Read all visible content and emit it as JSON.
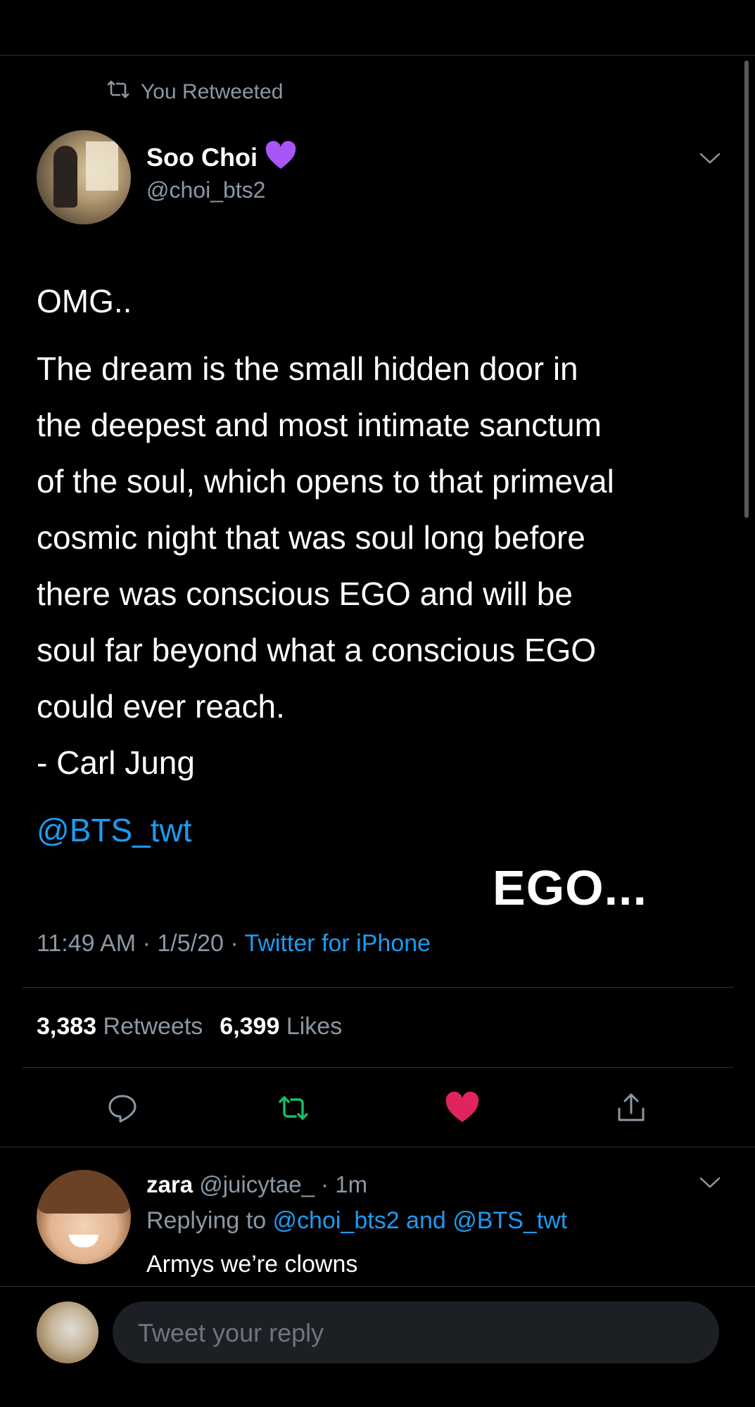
{
  "retweet_banner": {
    "label": "You Retweeted"
  },
  "tweet": {
    "author": {
      "name": "Soo Choi",
      "handle": "@choi_bts2"
    },
    "text": [
      "OMG..",
      "The dream is the small hidden door in",
      "the deepest and most intimate sanctum",
      "of the soul, which opens to that primeval",
      "cosmic night that was soul long before",
      "there was conscious EGO and will be",
      "soul far beyond what a conscious EGO",
      "could ever reach.",
      "- Carl Jung"
    ],
    "mention": "@BTS_twt",
    "overlay_caption": "EGO...",
    "time": "11:49 AM · 1/5/20 · ",
    "source": "Twitter for iPhone",
    "stats": {
      "retweets_count": "3,383",
      "retweets_label": "Retweets",
      "likes_count": "6,399",
      "likes_label": "Likes"
    }
  },
  "reply": {
    "name": "zara",
    "meta": " @juicytae_ · 1m",
    "replying_prefix": "Replying to ",
    "replying_targets": "@choi_bts2 and @BTS_twt",
    "text": "Armys we’re clowns"
  },
  "composer": {
    "placeholder": "Tweet your reply"
  },
  "colors": {
    "accent": "#1d9bf0",
    "retweet": "#17bf63",
    "like": "#e0245e",
    "muted": "#8b98a5",
    "heart_emoji": "#a855f7"
  },
  "icons": [
    "retweet-icon",
    "purple-heart-icon",
    "chevron-down-icon",
    "reply-icon",
    "like-icon",
    "share-icon"
  ]
}
